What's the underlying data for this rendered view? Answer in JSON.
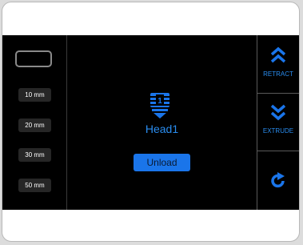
{
  "colors": {
    "accent": "#1a75ea",
    "accent_text": "#2a8df0",
    "screen_bg": "#000000",
    "step_button_bg": "#262626"
  },
  "left_panel": {
    "step_value": "",
    "steps": [
      "10 mm",
      "20 mm",
      "30 mm",
      "50 mm"
    ]
  },
  "center": {
    "head_number": "1",
    "head_label": "Head1",
    "unload_label": "Unload"
  },
  "right_panel": {
    "retract": {
      "label": "RETRACT",
      "icon": "double-chevron-up-icon"
    },
    "extrude": {
      "label": "EXTRUDE",
      "icon": "double-chevron-down-icon"
    },
    "refresh": {
      "icon": "refresh-icon"
    }
  }
}
